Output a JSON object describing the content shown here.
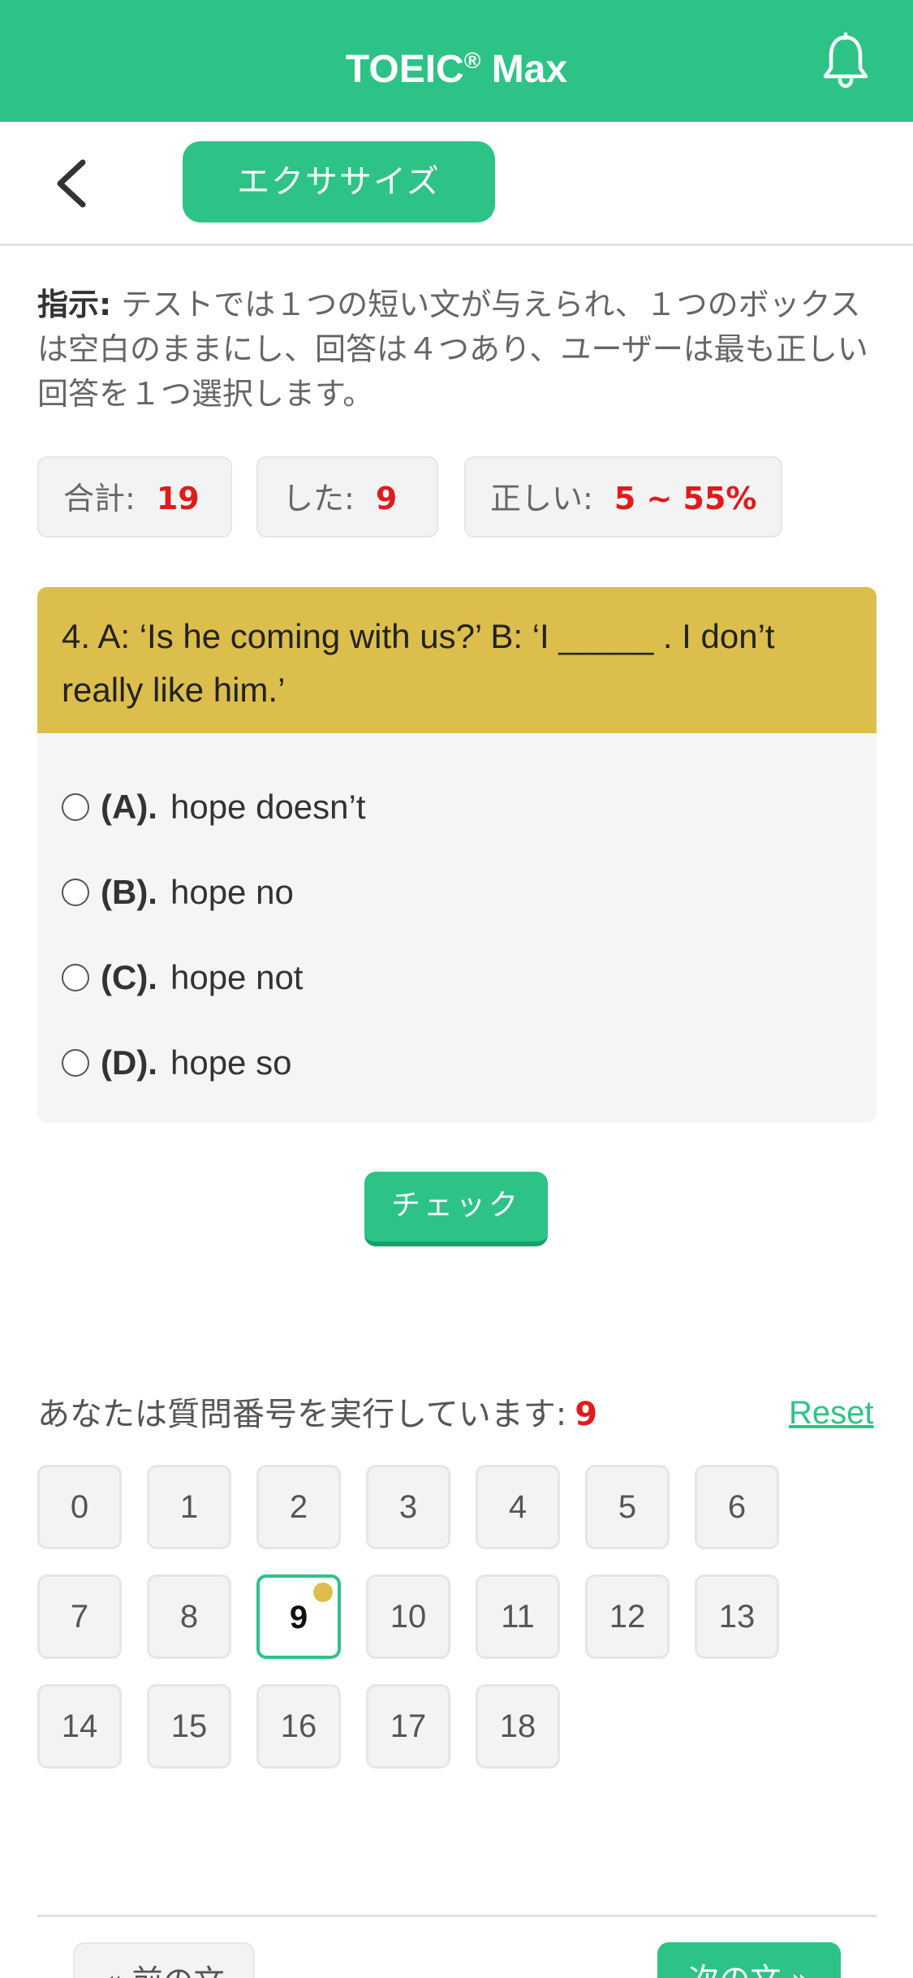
{
  "appbar": {
    "title": "TOEIC",
    "title_sup": "®",
    "title_suffix": " Max",
    "bell_icon": "bell-icon",
    "color": "#2ec386"
  },
  "subheader": {
    "back_icon": "chevron-left-icon",
    "tab_label": "エクササイズ"
  },
  "instructions": {
    "label": "指示:",
    "text": " テストでは１つの短い文が与えられ、１つのボックスは空白のままにし、回答は４つあり、ユーザーは最も正しい回答を１つ選択します。"
  },
  "stats": {
    "total_label": "合計:",
    "total_value": "19",
    "done_label": "した:",
    "done_value": "9",
    "correct_label": "正しい:",
    "correct_value": "5 ~ 55%"
  },
  "question": {
    "text": "4. A: ‘Is he coming with us?’ B: ‘I _____ . I don’t really like him.’",
    "options": [
      {
        "letter": "(A).",
        "text": "hope doesn’t"
      },
      {
        "letter": "(B).",
        "text": "hope no"
      },
      {
        "letter": "(C).",
        "text": "hope not"
      },
      {
        "letter": "(D).",
        "text": "hope so"
      }
    ],
    "header_color": "#dcbe4c"
  },
  "check_label": "チェック",
  "navigator": {
    "running_label": "あなたは質問番号を実行しています:",
    "current": "9",
    "reset_label": "Reset",
    "numbers": [
      "0",
      "1",
      "2",
      "3",
      "4",
      "5",
      "6",
      "7",
      "8",
      "9",
      "10",
      "11",
      "12",
      "13",
      "14",
      "15",
      "16",
      "17",
      "18"
    ]
  },
  "bottom": {
    "prev_label": "« 前の文",
    "next_label": "次の文 »"
  }
}
